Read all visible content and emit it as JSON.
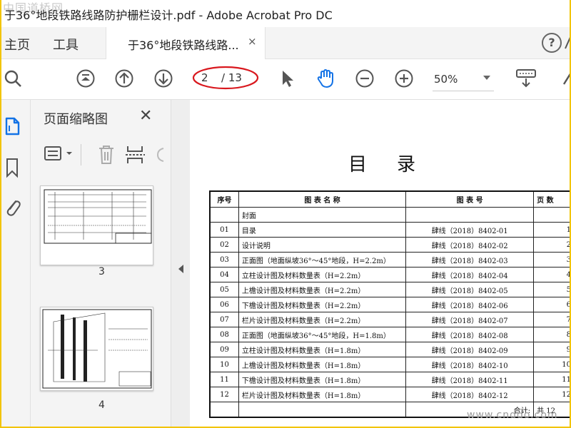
{
  "window": {
    "title": "于36°地段铁路线路防护栅栏设计.pdf - Adobe Acrobat Pro DC",
    "watermark_top_left": "中国道桥网",
    "watermark_bottom_right": "www.cnddo.com"
  },
  "tabs": {
    "home": "主页",
    "tools": "工具",
    "document": "于36°地段铁路线路...",
    "close_glyph": "×",
    "help_glyph": "?"
  },
  "toolbar": {
    "current_page": "2",
    "total_pages": "/ 13",
    "zoom": "50%"
  },
  "thumbnails_panel": {
    "title": "页面缩略图",
    "close_glyph": "✕",
    "pages": [
      {
        "number": "3"
      },
      {
        "number": "4"
      }
    ]
  },
  "document": {
    "title": "目录",
    "table": {
      "headers": [
        "序号",
        "图 表 名 称",
        "图 表 号",
        "页 数"
      ],
      "rows": [
        {
          "no": "",
          "name": "封面",
          "code": "",
          "page": ""
        },
        {
          "no": "01",
          "name": "目录",
          "code": "肆线（2018）8402-01",
          "page": "1"
        },
        {
          "no": "02",
          "name": "设计说明",
          "code": "肆线（2018）8402-02",
          "page": "2"
        },
        {
          "no": "03",
          "name": "正面图（地面纵坡36°～45°地段，H=2.2m）",
          "code": "肆线（2018）8402-03",
          "page": "3"
        },
        {
          "no": "04",
          "name": "立柱设计图及材料数量表（H=2.2m）",
          "code": "肆线（2018）8402-04",
          "page": "4"
        },
        {
          "no": "05",
          "name": "上檐设计图及材料数量表（H=2.2m）",
          "code": "肆线（2018）8402-05",
          "page": "5"
        },
        {
          "no": "06",
          "name": "下檐设计图及材料数量表（H=2.2m）",
          "code": "肆线（2018）8402-06",
          "page": "6"
        },
        {
          "no": "07",
          "name": "栏片设计图及材料数量表（H=2.2m）",
          "code": "肆线（2018）8402-07",
          "page": "7"
        },
        {
          "no": "08",
          "name": "正面图（地面纵坡36°～45°地段，H=1.8m）",
          "code": "肆线（2018）8402-08",
          "page": "8"
        },
        {
          "no": "09",
          "name": "立柱设计图及材料数量表（H=1.8m）",
          "code": "肆线（2018）8402-09",
          "page": "9"
        },
        {
          "no": "10",
          "name": "上檐设计图及材料数量表（H=1.8m）",
          "code": "肆线（2018）8402-10",
          "page": "10"
        },
        {
          "no": "11",
          "name": "下檐设计图及材料数量表（H=1.8m）",
          "code": "肆线（2018）8402-11",
          "page": "11"
        },
        {
          "no": "12",
          "name": "栏片设计图及材料数量表（H=1.8m）",
          "code": "肆线（2018）8402-12",
          "page": "12"
        }
      ],
      "total_label": "合计:",
      "total_value": "共 12"
    }
  },
  "colors": {
    "accent_blue": "#1473e6",
    "annotation_red": "#d9181e",
    "frame_yellow": "#f2c400"
  }
}
